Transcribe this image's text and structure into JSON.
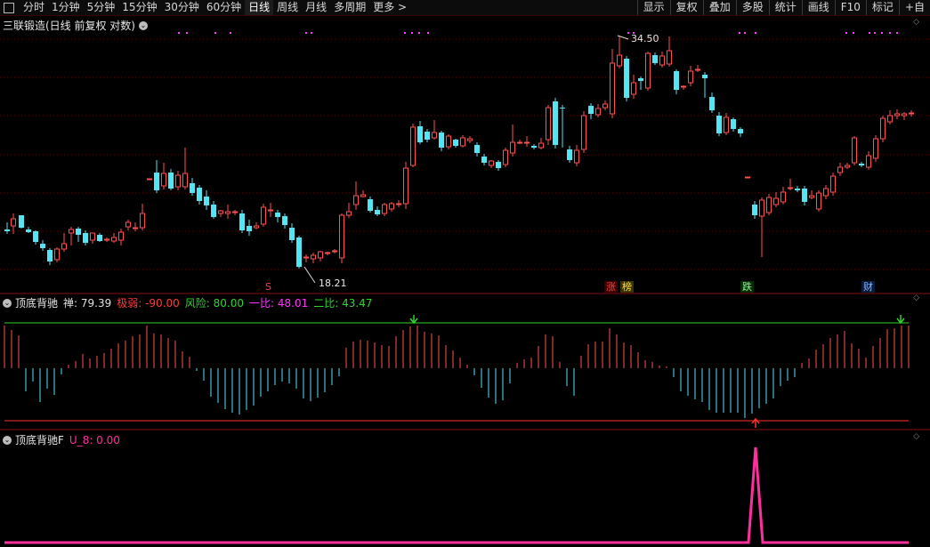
{
  "toolbar": {
    "periods": [
      "分时",
      "1分钟",
      "5分钟",
      "15分钟",
      "30分钟",
      "60分钟",
      "日线",
      "周线",
      "月线",
      "多周期",
      "更多"
    ],
    "active_period": "日线",
    "more_arrow": ">",
    "right_items": [
      "显示",
      "复权",
      "叠加",
      "多股",
      "统计",
      "画线",
      "F10",
      "标记",
      "+自"
    ]
  },
  "main_chart": {
    "title": "三联锻造(日线 前复权 对数)",
    "high_label": "34.50",
    "low_label": "18.21",
    "event_tags": [
      "S",
      "涨",
      "榜",
      "跌",
      "财"
    ]
  },
  "indicator1": {
    "name": "顶底背驰",
    "items": [
      {
        "label": "禅:",
        "value": "79.39",
        "color": "#e0e0e0"
      },
      {
        "label": "极弱:",
        "value": "-90.00",
        "color": "#ff3c3c"
      },
      {
        "label": "风险:",
        "value": "80.00",
        "color": "#31d331"
      },
      {
        "label": "一比:",
        "value": "48.01",
        "color": "#ff37ff"
      },
      {
        "label": "二比:",
        "value": "43.47",
        "color": "#31d331"
      }
    ]
  },
  "indicator2": {
    "name": "顶底背驰F",
    "items": [
      {
        "label": "U_8:",
        "value": "0.00",
        "color": "#ff2f9f"
      }
    ]
  },
  "colors": {
    "up": "#ff4f4f",
    "down": "#54e4f2",
    "green": "#31d331",
    "magenta": "#ff37ff",
    "pink": "#ff2f9f",
    "grid": "#5a0000"
  }
}
